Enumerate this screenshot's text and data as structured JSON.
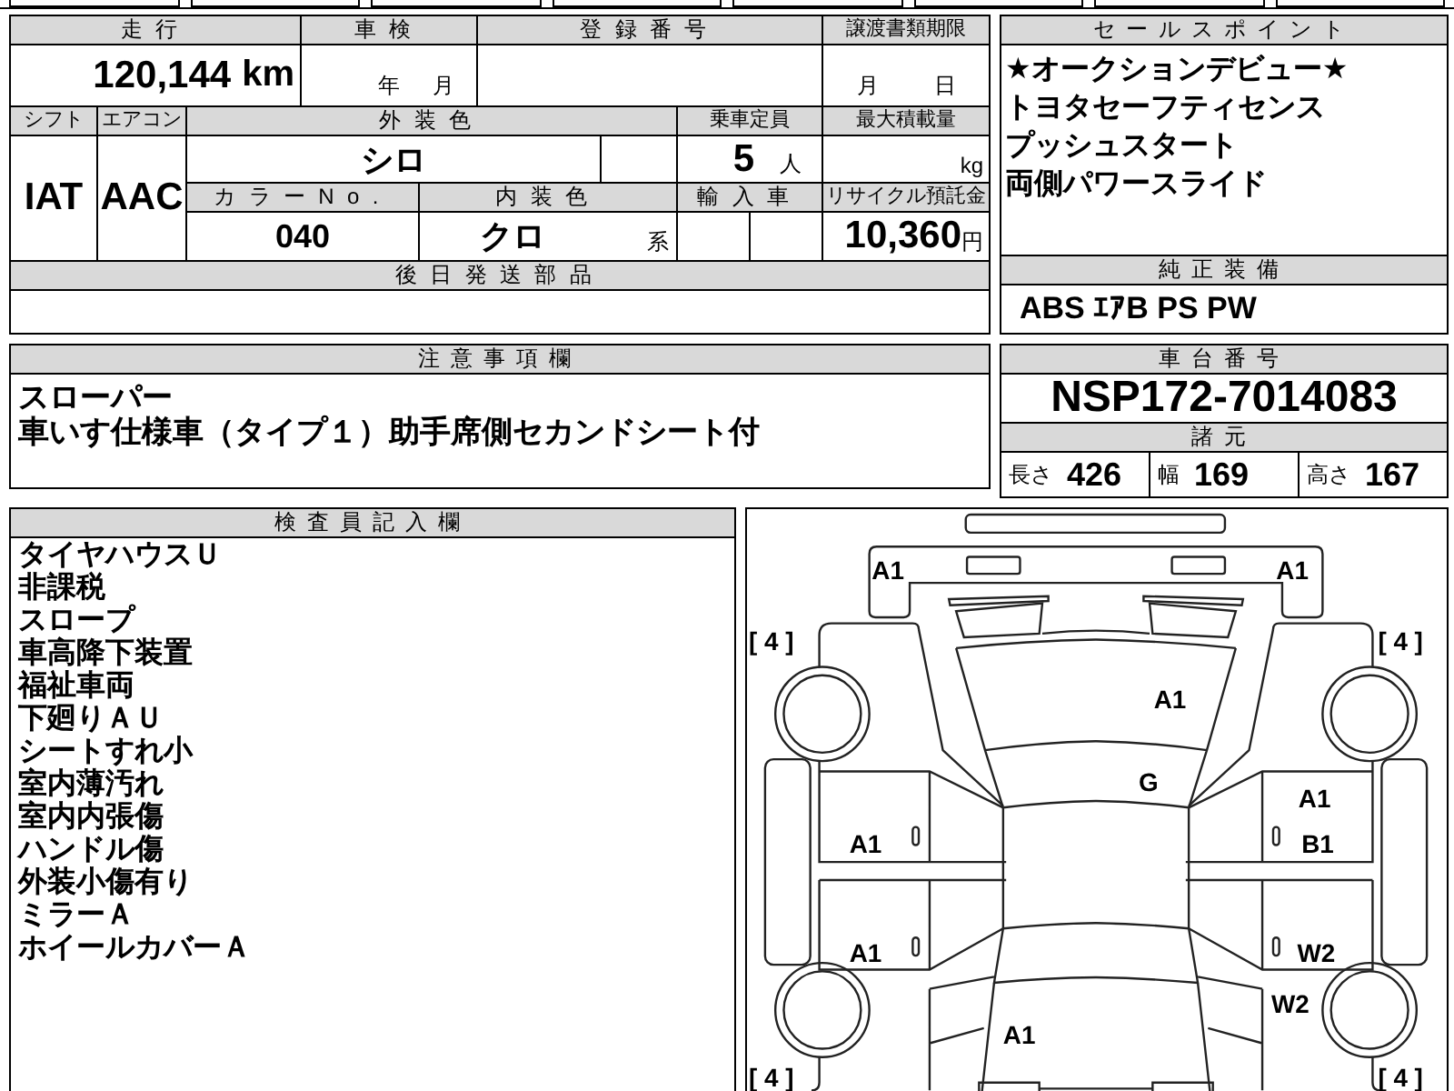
{
  "vehicle_table": {
    "mileage": {
      "label": "走行",
      "value": "120,144",
      "unit": "km"
    },
    "inspection": {
      "label": "車検",
      "year_unit": "年",
      "month_unit": "月"
    },
    "registration_number": {
      "label": "登録番号"
    },
    "transfer_document_deadline": {
      "label": "譲渡書類期限",
      "month_unit": "月",
      "day_unit": "日"
    },
    "shift": {
      "label": "シフト",
      "value": "IAT"
    },
    "air_conditioner": {
      "label": "エアコン",
      "value": "AAC"
    },
    "exterior_color": {
      "label": "外装色",
      "value": "シロ"
    },
    "seating_capacity": {
      "label": "乗車定員",
      "value": "5",
      "unit": "人"
    },
    "max_load": {
      "label": "最大積載量",
      "unit": "kg"
    },
    "color_number": {
      "label": "カラーNo.",
      "value": "040"
    },
    "interior_color": {
      "label": "内装色",
      "value": "クロ",
      "unit": "系"
    },
    "imported": {
      "label": "輸入車"
    },
    "recycling_deposit": {
      "label": "リサイクル預託金",
      "value": "10,360",
      "unit": "円"
    },
    "parts_shipped_later": {
      "label": "後日発送部品"
    }
  },
  "sales_points": {
    "label": "セールスポイント",
    "items": [
      "★オークションデビュー★",
      "トヨタセーフティセンス",
      "プッシュスタート",
      "両側パワースライド"
    ]
  },
  "standard_equipment": {
    "label": "純正装備",
    "value": "ABS ｴｱB PS PW"
  },
  "chassis_number": {
    "label": "車台番号",
    "value": "NSP172-7014083"
  },
  "dimensions": {
    "label": "諸元",
    "items": [
      {
        "label": "長さ",
        "value": "426"
      },
      {
        "label": "幅",
        "value": "169"
      },
      {
        "label": "高さ",
        "value": "167"
      }
    ]
  },
  "notes": {
    "label": "注意事項欄",
    "lines": [
      "スローパー",
      "車いす仕様車（タイプ１）助手席側セカンドシート付"
    ]
  },
  "inspector_notes": {
    "label": "検査員記入欄",
    "lines": [
      "タイヤハウスＵ",
      "非課税",
      "スロープ",
      "車高降下装置",
      "福祉車両",
      "下廻りＡＵ",
      "シートすれ小",
      "室内薄汚れ",
      "室内内張傷",
      "ハンドル傷",
      "外装小傷有り",
      "ミラーＡ",
      "ホイールカバーＡ"
    ]
  },
  "damage_diagram": {
    "tire_treads": {
      "front_left": "[ 4 ]",
      "front_right": "[ 4 ]",
      "rear_left": "[ 4 ]",
      "rear_right": "[ 4 ]"
    },
    "marks": {
      "front_bumper_left": [
        "A1"
      ],
      "front_bumper_right": [
        "A1"
      ],
      "hood": [
        "A1"
      ],
      "windshield": [
        "G"
      ],
      "right_front_door": [
        "A1",
        "B1"
      ],
      "left_front_door": [
        "A1"
      ],
      "left_rear_door": [
        "A1"
      ],
      "right_rear_door": [
        "W2"
      ],
      "right_rear_fender": [
        "W2"
      ],
      "rear_gate": [
        "A1"
      ]
    }
  }
}
